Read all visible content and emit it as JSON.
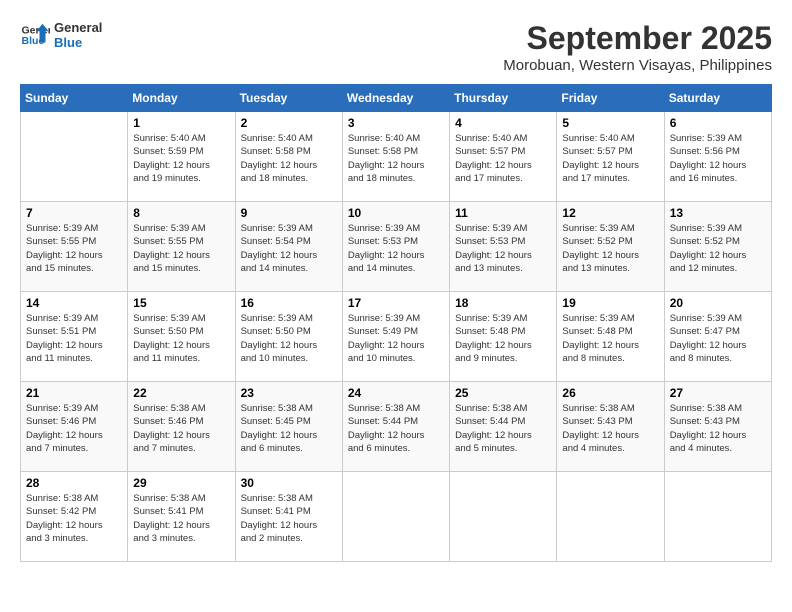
{
  "header": {
    "logo_line1": "General",
    "logo_line2": "Blue",
    "month": "September 2025",
    "location": "Morobuan, Western Visayas, Philippines"
  },
  "days_of_week": [
    "Sunday",
    "Monday",
    "Tuesday",
    "Wednesday",
    "Thursday",
    "Friday",
    "Saturday"
  ],
  "weeks": [
    [
      {
        "day": "",
        "info": ""
      },
      {
        "day": "1",
        "info": "Sunrise: 5:40 AM\nSunset: 5:59 PM\nDaylight: 12 hours\nand 19 minutes."
      },
      {
        "day": "2",
        "info": "Sunrise: 5:40 AM\nSunset: 5:58 PM\nDaylight: 12 hours\nand 18 minutes."
      },
      {
        "day": "3",
        "info": "Sunrise: 5:40 AM\nSunset: 5:58 PM\nDaylight: 12 hours\nand 18 minutes."
      },
      {
        "day": "4",
        "info": "Sunrise: 5:40 AM\nSunset: 5:57 PM\nDaylight: 12 hours\nand 17 minutes."
      },
      {
        "day": "5",
        "info": "Sunrise: 5:40 AM\nSunset: 5:57 PM\nDaylight: 12 hours\nand 17 minutes."
      },
      {
        "day": "6",
        "info": "Sunrise: 5:39 AM\nSunset: 5:56 PM\nDaylight: 12 hours\nand 16 minutes."
      }
    ],
    [
      {
        "day": "7",
        "info": "Sunrise: 5:39 AM\nSunset: 5:55 PM\nDaylight: 12 hours\nand 15 minutes."
      },
      {
        "day": "8",
        "info": "Sunrise: 5:39 AM\nSunset: 5:55 PM\nDaylight: 12 hours\nand 15 minutes."
      },
      {
        "day": "9",
        "info": "Sunrise: 5:39 AM\nSunset: 5:54 PM\nDaylight: 12 hours\nand 14 minutes."
      },
      {
        "day": "10",
        "info": "Sunrise: 5:39 AM\nSunset: 5:53 PM\nDaylight: 12 hours\nand 14 minutes."
      },
      {
        "day": "11",
        "info": "Sunrise: 5:39 AM\nSunset: 5:53 PM\nDaylight: 12 hours\nand 13 minutes."
      },
      {
        "day": "12",
        "info": "Sunrise: 5:39 AM\nSunset: 5:52 PM\nDaylight: 12 hours\nand 13 minutes."
      },
      {
        "day": "13",
        "info": "Sunrise: 5:39 AM\nSunset: 5:52 PM\nDaylight: 12 hours\nand 12 minutes."
      }
    ],
    [
      {
        "day": "14",
        "info": "Sunrise: 5:39 AM\nSunset: 5:51 PM\nDaylight: 12 hours\nand 11 minutes."
      },
      {
        "day": "15",
        "info": "Sunrise: 5:39 AM\nSunset: 5:50 PM\nDaylight: 12 hours\nand 11 minutes."
      },
      {
        "day": "16",
        "info": "Sunrise: 5:39 AM\nSunset: 5:50 PM\nDaylight: 12 hours\nand 10 minutes."
      },
      {
        "day": "17",
        "info": "Sunrise: 5:39 AM\nSunset: 5:49 PM\nDaylight: 12 hours\nand 10 minutes."
      },
      {
        "day": "18",
        "info": "Sunrise: 5:39 AM\nSunset: 5:48 PM\nDaylight: 12 hours\nand 9 minutes."
      },
      {
        "day": "19",
        "info": "Sunrise: 5:39 AM\nSunset: 5:48 PM\nDaylight: 12 hours\nand 8 minutes."
      },
      {
        "day": "20",
        "info": "Sunrise: 5:39 AM\nSunset: 5:47 PM\nDaylight: 12 hours\nand 8 minutes."
      }
    ],
    [
      {
        "day": "21",
        "info": "Sunrise: 5:39 AM\nSunset: 5:46 PM\nDaylight: 12 hours\nand 7 minutes."
      },
      {
        "day": "22",
        "info": "Sunrise: 5:38 AM\nSunset: 5:46 PM\nDaylight: 12 hours\nand 7 minutes."
      },
      {
        "day": "23",
        "info": "Sunrise: 5:38 AM\nSunset: 5:45 PM\nDaylight: 12 hours\nand 6 minutes."
      },
      {
        "day": "24",
        "info": "Sunrise: 5:38 AM\nSunset: 5:44 PM\nDaylight: 12 hours\nand 6 minutes."
      },
      {
        "day": "25",
        "info": "Sunrise: 5:38 AM\nSunset: 5:44 PM\nDaylight: 12 hours\nand 5 minutes."
      },
      {
        "day": "26",
        "info": "Sunrise: 5:38 AM\nSunset: 5:43 PM\nDaylight: 12 hours\nand 4 minutes."
      },
      {
        "day": "27",
        "info": "Sunrise: 5:38 AM\nSunset: 5:43 PM\nDaylight: 12 hours\nand 4 minutes."
      }
    ],
    [
      {
        "day": "28",
        "info": "Sunrise: 5:38 AM\nSunset: 5:42 PM\nDaylight: 12 hours\nand 3 minutes."
      },
      {
        "day": "29",
        "info": "Sunrise: 5:38 AM\nSunset: 5:41 PM\nDaylight: 12 hours\nand 3 minutes."
      },
      {
        "day": "30",
        "info": "Sunrise: 5:38 AM\nSunset: 5:41 PM\nDaylight: 12 hours\nand 2 minutes."
      },
      {
        "day": "",
        "info": ""
      },
      {
        "day": "",
        "info": ""
      },
      {
        "day": "",
        "info": ""
      },
      {
        "day": "",
        "info": ""
      }
    ]
  ]
}
